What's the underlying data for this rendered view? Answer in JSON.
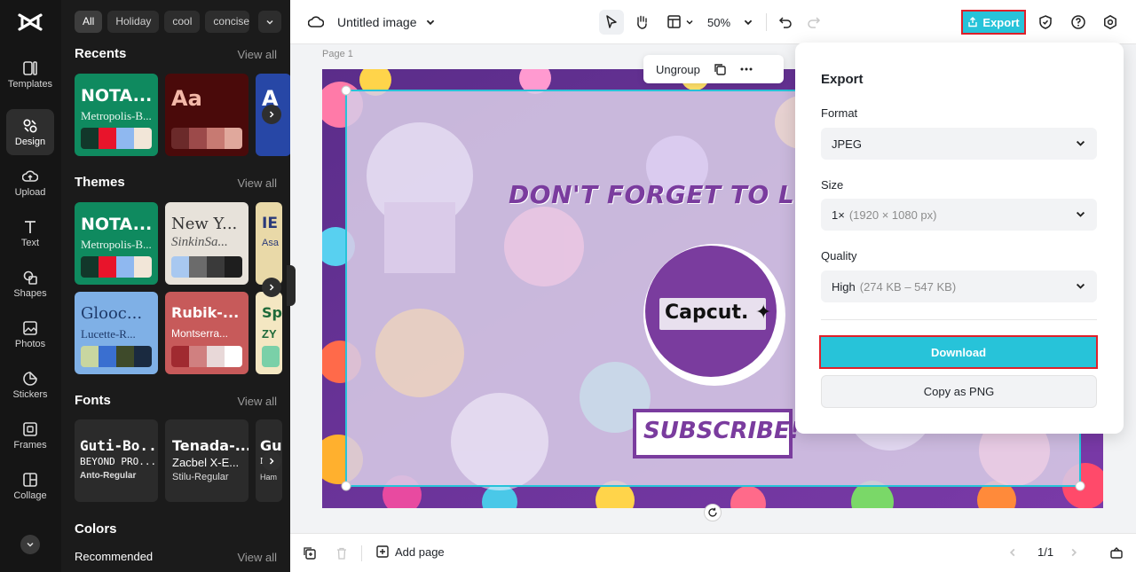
{
  "rail": {
    "items": [
      {
        "label": "Templates",
        "icon": "templates-icon"
      },
      {
        "label": "Design",
        "icon": "design-icon"
      },
      {
        "label": "Upload",
        "icon": "upload-icon"
      },
      {
        "label": "Text",
        "icon": "text-icon"
      },
      {
        "label": "Shapes",
        "icon": "shapes-icon"
      },
      {
        "label": "Photos",
        "icon": "photos-icon"
      },
      {
        "label": "Stickers",
        "icon": "stickers-icon"
      },
      {
        "label": "Frames",
        "icon": "frames-icon"
      },
      {
        "label": "Collage",
        "icon": "collage-icon"
      }
    ],
    "active": "Design"
  },
  "panel": {
    "chips": [
      "All",
      "Holiday",
      "cool",
      "concise"
    ],
    "recents": {
      "title": "Recents",
      "view_all": "View all",
      "cards": [
        {
          "t1": "NOTA...",
          "t2": "Metropolis-B...",
          "bg": "#0f8a5f",
          "swatches": [
            "#12372a",
            "#e8142b",
            "#8fb8f0",
            "#f2e6d8"
          ]
        },
        {
          "t1": "Aa",
          "t2": "",
          "bg": "#4a0a0a",
          "swatches": [
            "#6b2a2a",
            "#9c4a4a",
            "#c77a72",
            "#e0a89c"
          ]
        },
        {
          "t1": "A",
          "t2": "",
          "bg": "#2747a6",
          "swatches": []
        }
      ]
    },
    "themes": {
      "title": "Themes",
      "view_all": "View all",
      "cards": [
        {
          "t1": "NOTA...",
          "t2": "Metropolis-B...",
          "bg": "#0f8a5f",
          "swatches": [
            "#12372a",
            "#e8142b",
            "#8fb8f0",
            "#f2e6d8"
          ]
        },
        {
          "t1": "New Y...",
          "t2": "SinkinSa...",
          "bg": "#e7e2da",
          "swatches": [
            "#a8c8f0",
            "#6b6b6b",
            "#3a3a3a",
            "#1e1e1e"
          ]
        },
        {
          "t1": "IE",
          "t2": "Asa",
          "bg": "#e9d9a8",
          "swatches": []
        },
        {
          "t1": "Glooc...",
          "t2": "Lucette-R...",
          "bg": "#7fb0e6",
          "swatches": [
            "#c8d6a0",
            "#3a6fd0",
            "#3e4a2a",
            "#1a2a40"
          ]
        },
        {
          "t1": "Rubik-...",
          "t2": "Montserra...",
          "bg": "#c75a5a",
          "swatches": [
            "#a02a30",
            "#d08080",
            "#e8d8d8",
            "#ffffff"
          ]
        },
        {
          "t1": "Sp",
          "t2": "ZY",
          "bg": "#f4e7c2",
          "swatches": []
        }
      ]
    },
    "fonts": {
      "title": "Fonts",
      "view_all": "View all",
      "cards": [
        {
          "l1": "Guti-Bo...",
          "l2": "BEYOND PRO...",
          "l3": "Anto-Regular"
        },
        {
          "l1": "Tenada-...",
          "l2": "Zacbel X-E...",
          "l3": "Stilu-Regular"
        },
        {
          "l1": "Gu",
          "l2": "B",
          "l3": "Ham"
        }
      ]
    },
    "colors": {
      "title": "Colors",
      "recommended": "Recommended",
      "view_all": "View all"
    }
  },
  "topbar": {
    "title": "Untitled image",
    "zoom": "50%",
    "export_label": "Export"
  },
  "canvas": {
    "page_label": "Page 1",
    "heading": "DON'T FORGET TO LIKE &",
    "badge": "Capcut.",
    "subscribe": "SUBSCRIBE!",
    "ungroup": "Ungroup"
  },
  "bottombar": {
    "add_page": "Add page",
    "page_count": "1/1"
  },
  "export_panel": {
    "title": "Export",
    "format_label": "Format",
    "format_value": "JPEG",
    "size_label": "Size",
    "size_value": "1×",
    "size_detail": "(1920 × 1080 px)",
    "quality_label": "Quality",
    "quality_value": "High",
    "quality_detail": "(274 KB – 547 KB)",
    "download_label": "Download",
    "copy_label": "Copy as PNG"
  },
  "colors": {
    "accent": "#27c3d9",
    "highlight": "#e0202a",
    "purple": "#7a3c9e"
  }
}
